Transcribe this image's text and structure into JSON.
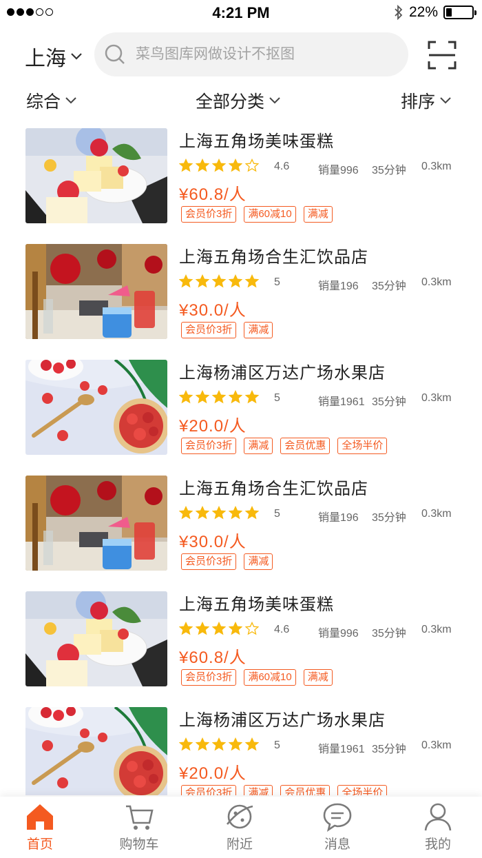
{
  "status_bar": {
    "time": "4:21 PM",
    "battery": "22%",
    "battery_level": 0.22,
    "signal_bars": 3,
    "signal_total": 5
  },
  "header": {
    "city": "上海",
    "search_placeholder": "菜鸟图库网做设计不抠图"
  },
  "filters": {
    "sort_all": "综合",
    "category": "全部分类",
    "order": "排序"
  },
  "colors": {
    "accent": "#f45a20",
    "star": "#f8b90c"
  },
  "stores": [
    {
      "name": "上海五角场美味蛋糕",
      "stars": 4,
      "rating": "4.6",
      "sales": "销量996",
      "time": "35分钟",
      "distance": "0.3km",
      "price": "¥60.8/人",
      "image": "cake",
      "tags": [
        "会员价3折",
        "满60减10",
        "满减"
      ]
    },
    {
      "name": "上海五角场合生汇饮品店",
      "stars": 5,
      "rating": "5",
      "sales": "销量196",
      "time": "35分钟",
      "distance": "0.3km",
      "price": "¥30.0/人",
      "image": "drink",
      "tags": [
        "会员价3折",
        "满减"
      ]
    },
    {
      "name": "上海杨浦区万达广场水果店",
      "stars": 5,
      "rating": "5",
      "sales": "销量1961",
      "time": "35分钟",
      "distance": "0.3km",
      "price": "¥20.0/人",
      "image": "strawberry",
      "tags": [
        "会员价3折",
        "满减",
        "会员优惠",
        "全场半价"
      ]
    },
    {
      "name": "上海五角场合生汇饮品店",
      "stars": 5,
      "rating": "5",
      "sales": "销量196",
      "time": "35分钟",
      "distance": "0.3km",
      "price": "¥30.0/人",
      "image": "drink",
      "tags": [
        "会员价3折",
        "满减"
      ]
    },
    {
      "name": "上海五角场美味蛋糕",
      "stars": 4,
      "rating": "4.6",
      "sales": "销量996",
      "time": "35分钟",
      "distance": "0.3km",
      "price": "¥60.8/人",
      "image": "cake",
      "tags": [
        "会员价3折",
        "满60减10",
        "满减"
      ]
    },
    {
      "name": "上海杨浦区万达广场水果店",
      "stars": 5,
      "rating": "5",
      "sales": "销量1961",
      "time": "35分钟",
      "distance": "0.3km",
      "price": "¥20.0/人",
      "image": "strawberry",
      "tags": [
        "会员价3折",
        "满减",
        "会员优惠",
        "全场半价"
      ]
    }
  ],
  "tabs": [
    {
      "label": "首页",
      "icon": "home-icon",
      "active": true
    },
    {
      "label": "购物车",
      "icon": "cart-icon",
      "active": false
    },
    {
      "label": "附近",
      "icon": "planet-icon",
      "active": false
    },
    {
      "label": "消息",
      "icon": "message-icon",
      "active": false
    },
    {
      "label": "我的",
      "icon": "user-icon",
      "active": false
    }
  ]
}
